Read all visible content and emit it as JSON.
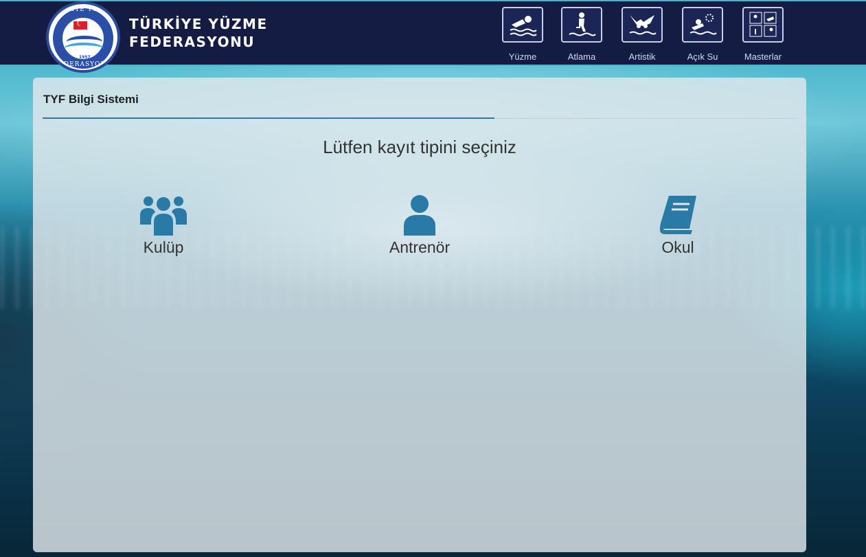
{
  "header": {
    "brand_line1": "TÜRKİYE YÜZME",
    "brand_line2": "FEDERASYONU",
    "logo": {
      "ring_top": "TÜRKİYE YÜZME",
      "ring_bottom": "FEDERASYONU",
      "year": "1957"
    },
    "nav": [
      {
        "label": "Yüzme",
        "icon": "swimmer-icon"
      },
      {
        "label": "Atlama",
        "icon": "diver-icon"
      },
      {
        "label": "Artistik",
        "icon": "synchronized-swimming-icon"
      },
      {
        "label": "Açık Su",
        "icon": "open-water-icon"
      },
      {
        "label": "Masterlar",
        "icon": "masters-icon"
      }
    ]
  },
  "panel": {
    "title": "TYF Bilgi Sistemi",
    "prompt": "Lütfen kayıt tipini seçiniz",
    "options": [
      {
        "label": "Kulüp",
        "icon": "users-group-icon"
      },
      {
        "label": "Antrenör",
        "icon": "user-icon"
      },
      {
        "label": "Okul",
        "icon": "book-icon"
      }
    ]
  },
  "colors": {
    "header_bg": "#141c44",
    "accent": "#2a7aa8",
    "header_border": "#4ab5c9"
  }
}
